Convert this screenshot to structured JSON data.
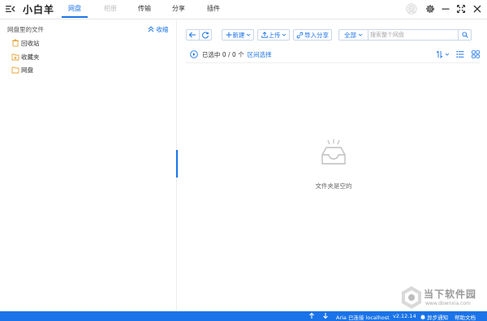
{
  "app": {
    "title": "小白羊"
  },
  "tabs": [
    {
      "label": "网盘",
      "state": "active"
    },
    {
      "label": "相册",
      "state": "disabled"
    },
    {
      "label": "传输",
      "state": "normal"
    },
    {
      "label": "分享",
      "state": "normal"
    },
    {
      "label": "插件",
      "state": "normal"
    }
  ],
  "top_icons": [
    "user-avatar-icon",
    "gear-icon",
    "minimize-icon",
    "maximize-icon",
    "close-icon"
  ],
  "sidebar": {
    "header": "网盘里的文件",
    "collapse_label": "收缩",
    "items": [
      {
        "label": "回收站",
        "icon": "trash-icon"
      },
      {
        "label": "收藏夹",
        "icon": "favorites-icon"
      },
      {
        "label": "网盘",
        "icon": "folder-icon"
      }
    ]
  },
  "toolbar": {
    "new_label": "新建",
    "upload_label": "上传",
    "import_share_label": "导入分享",
    "scope_label": "全部",
    "search_placeholder": "搜索整个网盘"
  },
  "selection": {
    "text": "已选中 0 / 0 个",
    "range_label": "区间选择"
  },
  "empty_state": {
    "text": "文件夹是空的"
  },
  "status": {
    "aria_text": "Aria 已连接 localhost",
    "version": "v2.12.14",
    "sync_label": "异步通知",
    "help_label": "帮助文档"
  },
  "watermark": {
    "title": "当下软件园",
    "url": "www.downxia.com"
  },
  "colors": {
    "accent": "#1a73e8",
    "statusbar": "#1a73e8",
    "folder": "#e8a33a",
    "disabled_tab": "#c2c2c2"
  }
}
